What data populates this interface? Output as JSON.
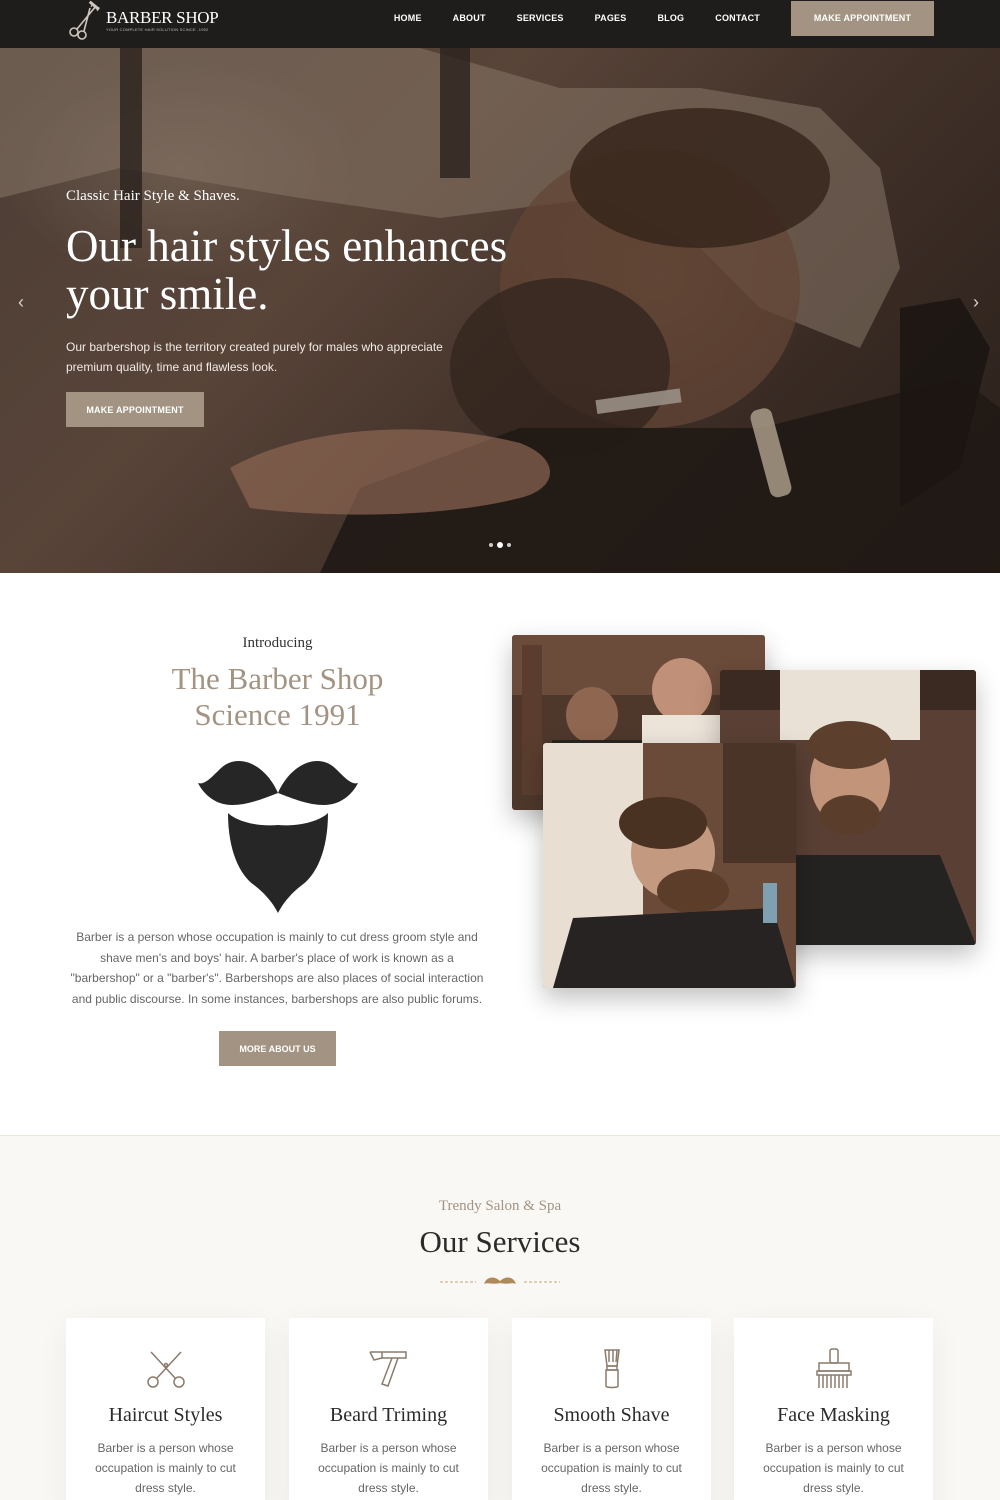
{
  "nav": {
    "logo_name": "BARBER SHOP",
    "logo_tagline": "YOUR COMPLETE HAIR SOLUTION SCINCE -1952",
    "items": [
      "HOME",
      "ABOUT",
      "SERVICES",
      "PAGES",
      "BLOG",
      "CONTACT"
    ],
    "cta": "MAKE APPOINTMENT"
  },
  "hero": {
    "subtitle": "Classic Hair Style & Shaves.",
    "title": "Our hair styles enhances your smile.",
    "description": "Our barbershop is the territory created purely for males who appreciate premium quality, time and flawless look.",
    "button": "MAKE APPOINTMENT",
    "prev_icon": "chevron-left-icon",
    "next_icon": "chevron-right-icon",
    "slides_total": 3,
    "active_slide": 2
  },
  "intro": {
    "label": "Introducing",
    "title_line1": "The Barber Shop",
    "title_line2": "Science 1991",
    "text": "Barber is a person whose occupation is mainly to cut dress groom style and shave men's and boys' hair. A barber's place of work is known as a \"barbershop\" or a \"barber's\". Barbershops are also places of social interaction and public discourse. In some instances, barbershops are also public forums.",
    "button": "MORE ABOUT US"
  },
  "services": {
    "subtitle": "Trendy Salon & Spa",
    "title": "Our Services",
    "items": [
      {
        "icon": "scissors-icon",
        "title": "Haircut Styles",
        "text": "Barber is a person whose occupation is mainly to cut dress style."
      },
      {
        "icon": "razor-icon",
        "title": "Beard Triming",
        "text": "Barber is a person whose occupation is mainly to cut dress style."
      },
      {
        "icon": "shaving-brush-icon",
        "title": "Smooth Shave",
        "text": "Barber is a person whose occupation is mainly to cut dress style."
      },
      {
        "icon": "face-mask-brush-icon",
        "title": "Face Masking",
        "text": "Barber is a person whose occupation is mainly to cut dress style."
      }
    ]
  },
  "colors": {
    "accent": "#a39382",
    "nav_bg": "#1f1d1c",
    "section_bg": "#faf8f5"
  }
}
